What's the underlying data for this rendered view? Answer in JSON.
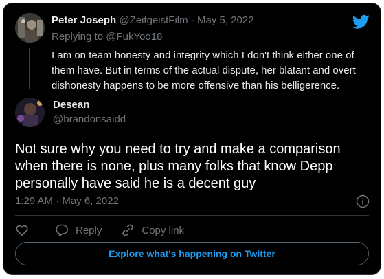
{
  "parent_tweet": {
    "author_name": "Peter Joseph",
    "handle": "@ZeitgeistFilm",
    "separator": "·",
    "date": "May 5, 2022",
    "replying_prefix": "Replying to",
    "replying_to": "@FukYoo18",
    "text": "I am on team honesty and integrity which I don't think either one of them have. But in terms of the actual dispute, her blatant and overt dishonesty happens to be more offensive than his belligerence."
  },
  "tweet": {
    "author_name": "Desean",
    "handle": "@brandonsaidd",
    "text": "Not sure why you need to try and make a comparison when there is none, plus many folks that know Depp personally have said he is a decent guy",
    "timestamp": "1:29 AM · May 6, 2022"
  },
  "actions": {
    "reply_label": "Reply",
    "copy_link_label": "Copy link"
  },
  "explore_button_label": "Explore what's happening on Twitter",
  "colors": {
    "background": "#000000",
    "accent": "#1d9bf0",
    "muted": "#71767b",
    "border": "#2f3336"
  },
  "icons": [
    "twitter-logo-icon",
    "info-icon",
    "heart-icon",
    "reply-icon",
    "link-icon"
  ]
}
